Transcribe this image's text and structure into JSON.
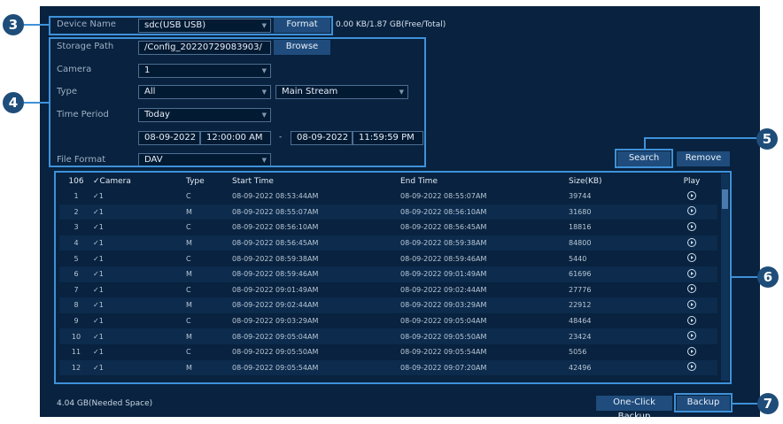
{
  "device": {
    "label": "Device Name",
    "value": "sdc(USB USB)",
    "format_label": "Format",
    "capacity": "0.00 KB/1.87 GB(Free/Total)"
  },
  "storage": {
    "label": "Storage Path",
    "value": "/Config_20220729083903/",
    "browse_label": "Browse"
  },
  "camera": {
    "label": "Camera",
    "value": "1"
  },
  "type": {
    "label": "Type",
    "value": "All",
    "stream": "Main Stream"
  },
  "time_period": {
    "label": "Time Period",
    "value": "Today",
    "start_date": "08-09-2022",
    "start_time": "12:00:00 AM",
    "separator": "-",
    "end_date": "08-09-2022",
    "end_time": "11:59:59 PM"
  },
  "file_format": {
    "label": "File Format",
    "value": "DAV"
  },
  "actions": {
    "search_label": "Search",
    "remove_label": "Remove",
    "one_click_label": "One-Click Backup",
    "backup_label": "Backup"
  },
  "needed_space": "4.04 GB(Needed Space)",
  "callouts": [
    "3",
    "4",
    "5",
    "6",
    "7"
  ],
  "table": {
    "headers": {
      "count": "106",
      "camera": "Camera",
      "type": "Type",
      "start": "Start Time",
      "end": "End Time",
      "size": "Size(KB)",
      "play": "Play"
    },
    "rows": [
      {
        "no": "1",
        "cam": "1",
        "type": "C",
        "start": "08-09-2022 08:53:44AM",
        "end": "08-09-2022 08:55:07AM",
        "size": "39744"
      },
      {
        "no": "2",
        "cam": "1",
        "type": "M",
        "start": "08-09-2022 08:55:07AM",
        "end": "08-09-2022 08:56:10AM",
        "size": "31680"
      },
      {
        "no": "3",
        "cam": "1",
        "type": "C",
        "start": "08-09-2022 08:56:10AM",
        "end": "08-09-2022 08:56:45AM",
        "size": "18816"
      },
      {
        "no": "4",
        "cam": "1",
        "type": "M",
        "start": "08-09-2022 08:56:45AM",
        "end": "08-09-2022 08:59:38AM",
        "size": "84800"
      },
      {
        "no": "5",
        "cam": "1",
        "type": "C",
        "start": "08-09-2022 08:59:38AM",
        "end": "08-09-2022 08:59:46AM",
        "size": "5440"
      },
      {
        "no": "6",
        "cam": "1",
        "type": "M",
        "start": "08-09-2022 08:59:46AM",
        "end": "08-09-2022 09:01:49AM",
        "size": "61696"
      },
      {
        "no": "7",
        "cam": "1",
        "type": "C",
        "start": "08-09-2022 09:01:49AM",
        "end": "08-09-2022 09:02:44AM",
        "size": "27776"
      },
      {
        "no": "8",
        "cam": "1",
        "type": "M",
        "start": "08-09-2022 09:02:44AM",
        "end": "08-09-2022 09:03:29AM",
        "size": "22912"
      },
      {
        "no": "9",
        "cam": "1",
        "type": "C",
        "start": "08-09-2022 09:03:29AM",
        "end": "08-09-2022 09:05:04AM",
        "size": "48464"
      },
      {
        "no": "10",
        "cam": "1",
        "type": "M",
        "start": "08-09-2022 09:05:04AM",
        "end": "08-09-2022 09:05:50AM",
        "size": "23424"
      },
      {
        "no": "11",
        "cam": "1",
        "type": "C",
        "start": "08-09-2022 09:05:50AM",
        "end": "08-09-2022 09:05:54AM",
        "size": "5056"
      },
      {
        "no": "12",
        "cam": "1",
        "type": "M",
        "start": "08-09-2022 09:05:54AM",
        "end": "08-09-2022 09:07:20AM",
        "size": "42496"
      }
    ]
  }
}
